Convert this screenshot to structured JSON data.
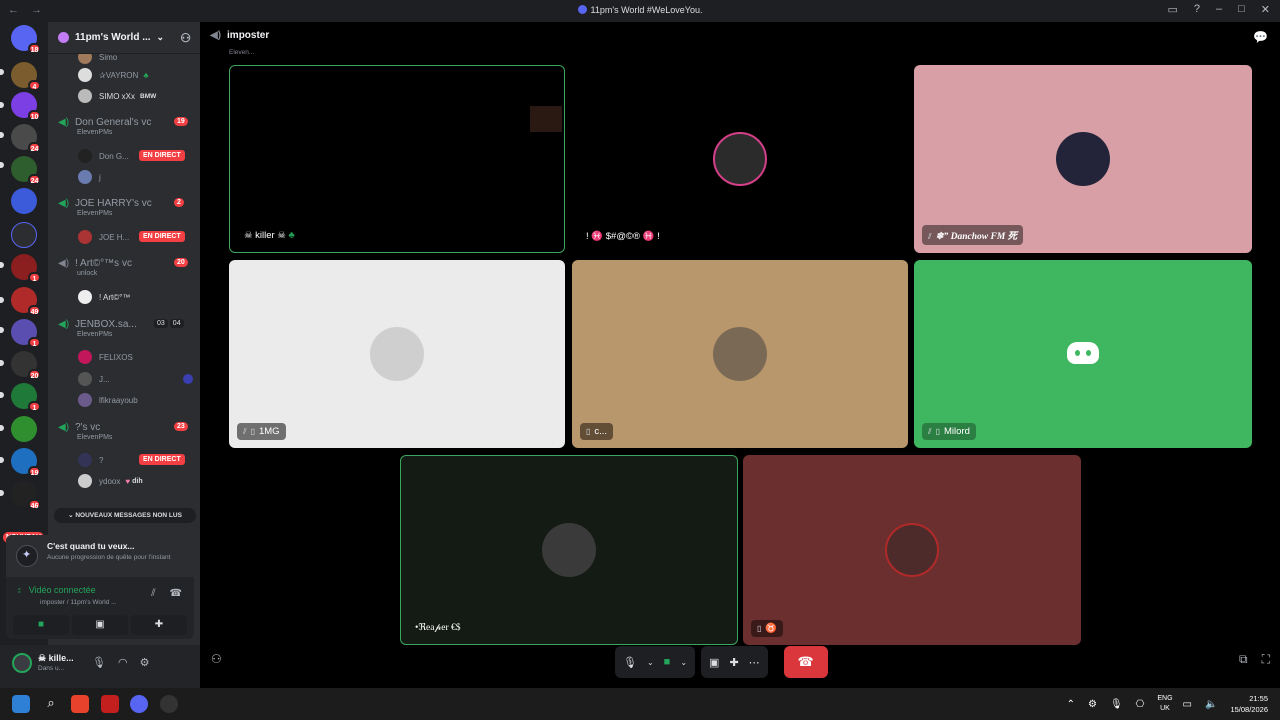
{
  "window": {
    "title": "11pm's World #WeLoveYou."
  },
  "servers": {
    "nouveau_label": "NOUVEAU",
    "items": [
      {
        "badge": "18",
        "color": "#5865f2"
      },
      {
        "badge": "4",
        "color": "#7a5c2e"
      },
      {
        "badge": "10",
        "color": "#7b3fe4"
      },
      {
        "badge": "24",
        "color": "#4a4a4a"
      },
      {
        "badge": "24",
        "color": "#2e5e2e"
      },
      {
        "badge": "",
        "color": "#3b5bdb"
      },
      {
        "badge": "",
        "color": "#5865f2"
      },
      {
        "badge": "1",
        "color": "#8b1e1e"
      },
      {
        "badge": "49",
        "color": "#b02a2a"
      },
      {
        "badge": "1",
        "color": "#5a4fb0"
      },
      {
        "badge": "20",
        "color": "#333333"
      },
      {
        "badge": "1",
        "color": "#1f7a3a"
      },
      {
        "badge": "",
        "color": "#2f8f2f"
      },
      {
        "badge": "19",
        "color": "#1e6fbf"
      },
      {
        "badge": "46",
        "color": "#222222"
      }
    ]
  },
  "sidebar": {
    "server_name": "11pm's World ...",
    "top_members": [
      {
        "name": "Simo"
      },
      {
        "name": "✰VAYRON"
      },
      {
        "name": "SIMO xXx",
        "tag": "BMW"
      }
    ],
    "channels": [
      {
        "name": "Don General's vc",
        "sub": "ElevenPMs",
        "count": "19",
        "members": [
          {
            "name": "Don G...",
            "live": "EN DIRECT"
          },
          {
            "name": "j"
          }
        ]
      },
      {
        "name": "JOE HARRY's vc",
        "sub": "ElevenPMs",
        "count": "2",
        "members": [
          {
            "name": "JOE H...",
            "live": "EN DIRECT"
          }
        ]
      },
      {
        "name": "! Art©°™s vc",
        "sub": "unlock",
        "count": "20",
        "members": [
          {
            "name": "! Art©°™"
          }
        ]
      },
      {
        "name": "JENBOX.sa...",
        "sub": "ElevenPMs",
        "count_a": "03",
        "count_b": "04",
        "members": [
          {
            "name": "FELIXOS"
          },
          {
            "name": "J..."
          },
          {
            "name": "lfikraayoub"
          }
        ]
      },
      {
        "name": "?'s vc",
        "sub": "ElevenPMs",
        "count": "23",
        "members": [
          {
            "name": "?",
            "live": "EN DIRECT"
          },
          {
            "name": "ydoox",
            "tag": "dih"
          }
        ]
      }
    ],
    "new_messages": "NOUVEAUX MESSAGES NON LUS"
  },
  "quest": {
    "title": "C'est quand tu veux...",
    "subtitle": "Aucune progression de quête pour l'instant"
  },
  "voice": {
    "status": "Vidéo connectée",
    "location": "imposter / 11pm's World ..."
  },
  "user": {
    "name": "☠ kille...",
    "status": "Dans u..."
  },
  "main": {
    "channel_name": "imposter",
    "channel_sub": "Eleven...",
    "tiles": [
      {
        "label": "☠ killer ☠",
        "bg": "#000000",
        "border": "#3ba55d",
        "avatar": ""
      },
      {
        "label": "! ♓ $#@©® ♓ !",
        "bg": "#000000",
        "border": "",
        "avatar": "#2b2b2b"
      },
      {
        "label": "❄” Danchow FM 死",
        "bg": "#d8a0a6",
        "border": "",
        "avatar": "#23243a"
      },
      {
        "label": "1MG",
        "bg": "#ebebeb",
        "border": "",
        "avatar": "#cfcfcf"
      },
      {
        "label": "c...",
        "bg": "#b9976c",
        "border": "",
        "avatar": "#7a6a55"
      },
      {
        "label": "Milord",
        "bg": "#3fb760",
        "border": "",
        "avatar": ""
      },
      {
        "label": "•ℜea𝓅er €$",
        "bg": "#141a14",
        "border": "#3ba55d",
        "avatar": "#3a3a3a"
      },
      {
        "label": "♉",
        "bg": "#6b2f2f",
        "border": "",
        "avatar": "#4d2b2b"
      }
    ]
  },
  "taskbar": {
    "lang_1": "ENG",
    "lang_2": "UK",
    "time": "21:55",
    "date": "15/08/2026"
  }
}
